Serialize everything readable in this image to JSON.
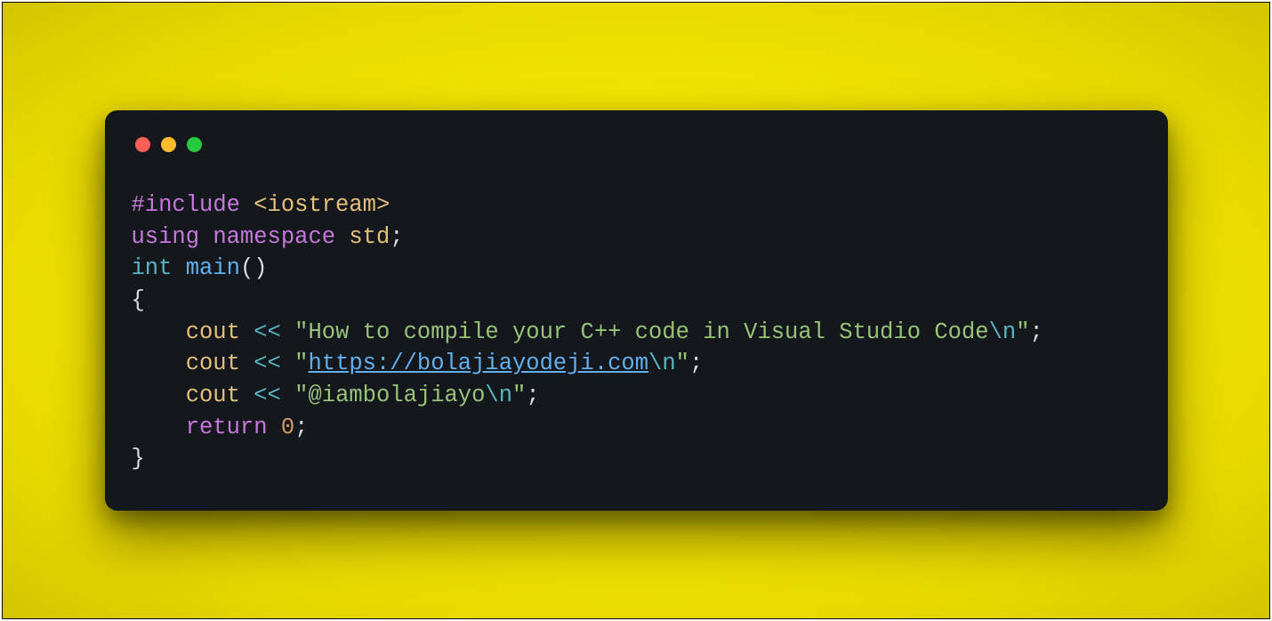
{
  "window": {
    "traffic_light_colors": {
      "close": "#ff5f56",
      "minimize": "#ffbd2e",
      "zoom": "#27c93f"
    },
    "background_color": "#14171c"
  },
  "code": {
    "language": "cpp",
    "line1": {
      "include_directive": "#include ",
      "header": "<iostream>"
    },
    "line2": {
      "using": "using",
      "namespace": "namespace",
      "std": "std",
      "semi": ";"
    },
    "line3": {
      "type": "int",
      "func": "main",
      "parens": "()"
    },
    "line4": {
      "brace": "{"
    },
    "line5": {
      "cout": "cout",
      "op": "<<",
      "q1": "\"",
      "str": "How to compile your C++ code in Visual Studio Code",
      "esc": "\\n",
      "q2": "\"",
      "semi": ";"
    },
    "line6": {
      "cout": "cout",
      "op": "<<",
      "q1": "\"",
      "url": "https://bolajiayodeji.com",
      "esc": "\\n",
      "q2": "\"",
      "semi": ";"
    },
    "line7": {
      "cout": "cout",
      "op": "<<",
      "q1": "\"",
      "str": "@iambolajiayo",
      "esc": "\\n",
      "q2": "\"",
      "semi": ";"
    },
    "line8": {
      "return": "return",
      "value": "0",
      "semi": ";"
    },
    "line9": {
      "brace": "}"
    }
  }
}
